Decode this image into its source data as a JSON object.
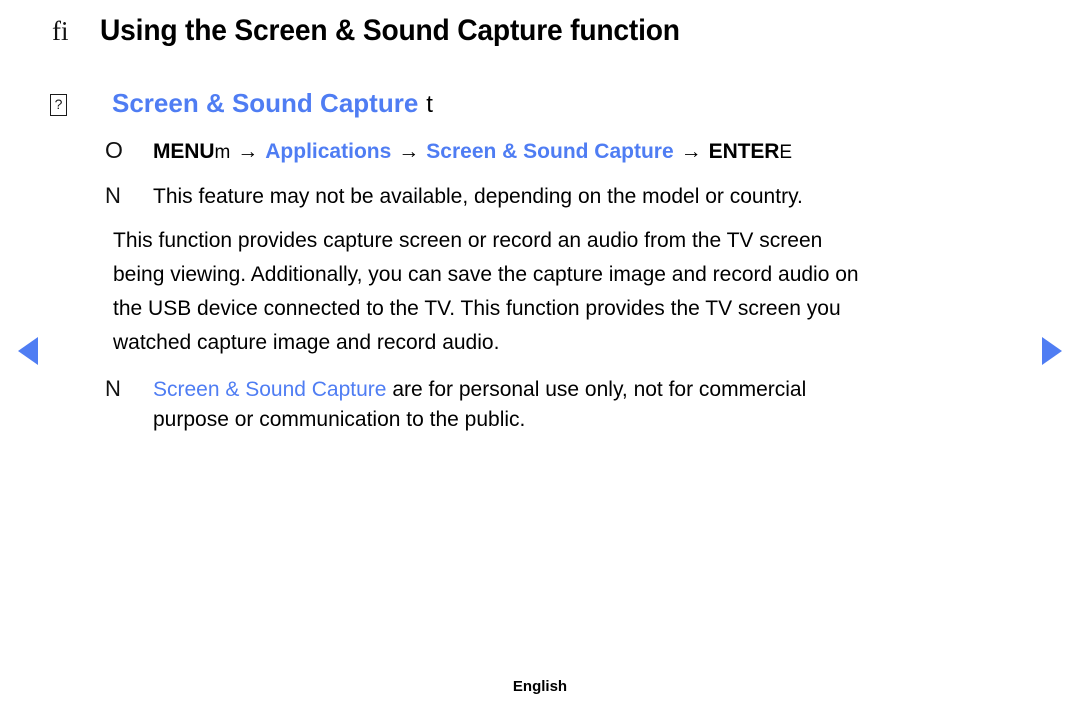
{
  "page": {
    "title_marker": "fi",
    "title": "Using the Screen & Sound Capture function",
    "footer": "English"
  },
  "section": {
    "bullet_glyph": "?",
    "heading": "Screen & Sound Capture",
    "suffix": "t"
  },
  "menu_path": {
    "marker": "O",
    "key_bold": "MENU",
    "key_light": "m",
    "arrow": "→",
    "step1": "Applications",
    "step2": "Screen & Sound Capture",
    "enter_bold": "ENTER",
    "enter_light": "E"
  },
  "notes": [
    {
      "marker": "N",
      "text": "This feature may not be available, depending on the model or country."
    }
  ],
  "paragraph": {
    "lines": [
      "This function provides capture screen or record an audio from the TV screen",
      "being viewing. Additionally, you can save the capture image and record audio on",
      "the USB device connected to the TV. This function provides the TV screen you",
      "watched capture image and record audio."
    ]
  },
  "note_commercial": {
    "marker": "N",
    "highlight": "Screen & Sound Capture",
    "rest": " are for personal use only, not for commercial",
    "line2": "purpose or communication to the public."
  },
  "nav": {
    "prev_icon": "triangle-left",
    "next_icon": "triangle-right"
  },
  "colors": {
    "accent_blue": "#4f7df3",
    "text_black": "#000000",
    "background": "#ffffff"
  }
}
